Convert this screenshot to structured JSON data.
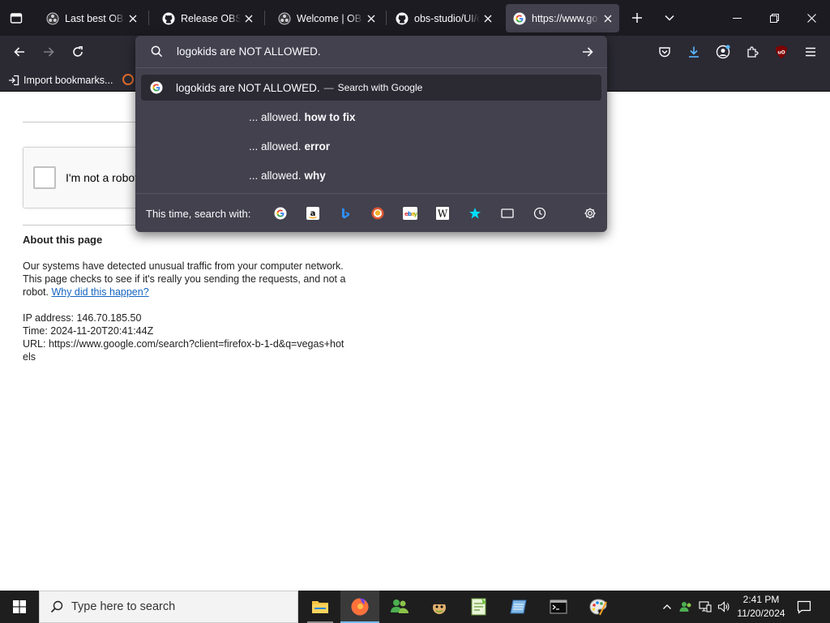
{
  "browser": {
    "tabs": [
      {
        "title": "Last best OBS ve",
        "icon": "obs-icon",
        "active": false
      },
      {
        "title": "Release OBS Stu",
        "icon": "github-icon",
        "active": false
      },
      {
        "title": "Welcome | OBS",
        "icon": "obs-icon",
        "active": false
      },
      {
        "title": "obs-studio/UI/c",
        "icon": "github-icon",
        "active": false
      },
      {
        "title": "https://www.go",
        "icon": "google-icon",
        "active": true
      }
    ],
    "bookmarks": {
      "import_label": "Import bookmarks..."
    }
  },
  "urlbar": {
    "value": "logokids are NOT ALLOWED.",
    "main_suggestion": {
      "query": "logokids are NOT ALLOWED.",
      "dash": "—",
      "action": "Search with Google"
    },
    "suggestions": [
      {
        "prefix": "... allowed.",
        "bold": "how to fix"
      },
      {
        "prefix": "... allowed.",
        "bold": "error"
      },
      {
        "prefix": "... allowed.",
        "bold": "why"
      }
    ],
    "oneoff_label": "This time, search with:",
    "engines": [
      "google-icon",
      "amazon-icon",
      "bing-icon",
      "duckduckgo-icon",
      "ebay-icon",
      "wikipedia-icon",
      "bookmarks-star-icon",
      "tabs-icon",
      "history-icon",
      "settings-gear-icon"
    ]
  },
  "page": {
    "captcha_label": "I'm not a robot",
    "about_title": "About this page",
    "about_text": "Our systems have detected unusual traffic from your computer network. This page checks to see if it's really you sending the requests, and not a robot.",
    "why_link": "Why did this happen?",
    "ip_line": "IP address: 146.70.185.50",
    "time_line": "Time: 2024-11-20T20:41:44Z",
    "url_line": "URL: https://www.google.com/search?client=firefox-b-1-d&q=vegas+hotels"
  },
  "taskbar": {
    "search_placeholder": "Type here to search",
    "time": "2:41 PM",
    "date": "11/20/2024"
  }
}
